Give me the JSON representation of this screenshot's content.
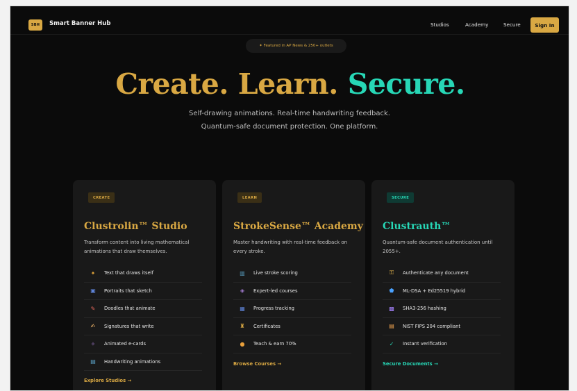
{
  "header": {
    "logo_text": "SBH",
    "brand": "Smart Banner Hub",
    "nav": [
      "Studios",
      "Academy",
      "Secure"
    ],
    "signin": "Sign In"
  },
  "featured": "✦ Featured in AP News & 250+ outlets",
  "hero": {
    "create": "Create.",
    "learn": "Learn.",
    "secure": "Secure.",
    "subtitle": "Self-drawing animations. Real-time handwriting feedback. Quantum-safe document protection. One platform."
  },
  "cards": [
    {
      "tag": "CREATE",
      "title": "Clustrolin™ Studio",
      "desc": "Transform content into living mathematical animations that draw themselves.",
      "features": [
        "Text that draws itself",
        "Portraits that sketch",
        "Doodles that animate",
        "Signatures that write",
        "Animated e-cards",
        "Handwriting animations"
      ],
      "link": "Explore Studios →"
    },
    {
      "tag": "LEARN",
      "title": "StrokeSense™ Academy",
      "desc": "Master handwriting with real-time feedback on every stroke.",
      "features": [
        "Live stroke scoring",
        "Expert-led courses",
        "Progress tracking",
        "Certificates",
        "Teach & earn 70%"
      ],
      "link": "Browse Courses →"
    },
    {
      "tag": "SECURE",
      "title": "Clustrauth™",
      "desc": "Quantum-safe document authentication until 2055+.",
      "features": [
        "Authenticate any document",
        "ML-DSA + Ed25519 hybrid",
        "SHA3-256 hashing",
        "NIST FIPS 204 compliant",
        "Instant verification"
      ],
      "link": "Secure Documents →"
    }
  ],
  "colors": {
    "gold": "#d9a843",
    "teal": "#27d7b6",
    "background": "#0b0b0b",
    "card": "#191919"
  },
  "icons": {
    "create": [
      "sparkles-icon",
      "portrait-icon",
      "crayon-icon",
      "hand-write-icon",
      "party-icon",
      "chart-icon"
    ],
    "learn": [
      "bar-chart-icon",
      "graduation-icon",
      "trend-icon",
      "trophy-icon",
      "money-bag-icon"
    ],
    "secure": [
      "lock-icon",
      "shield-icon",
      "hash-icon",
      "document-icon",
      "check-icon"
    ]
  }
}
